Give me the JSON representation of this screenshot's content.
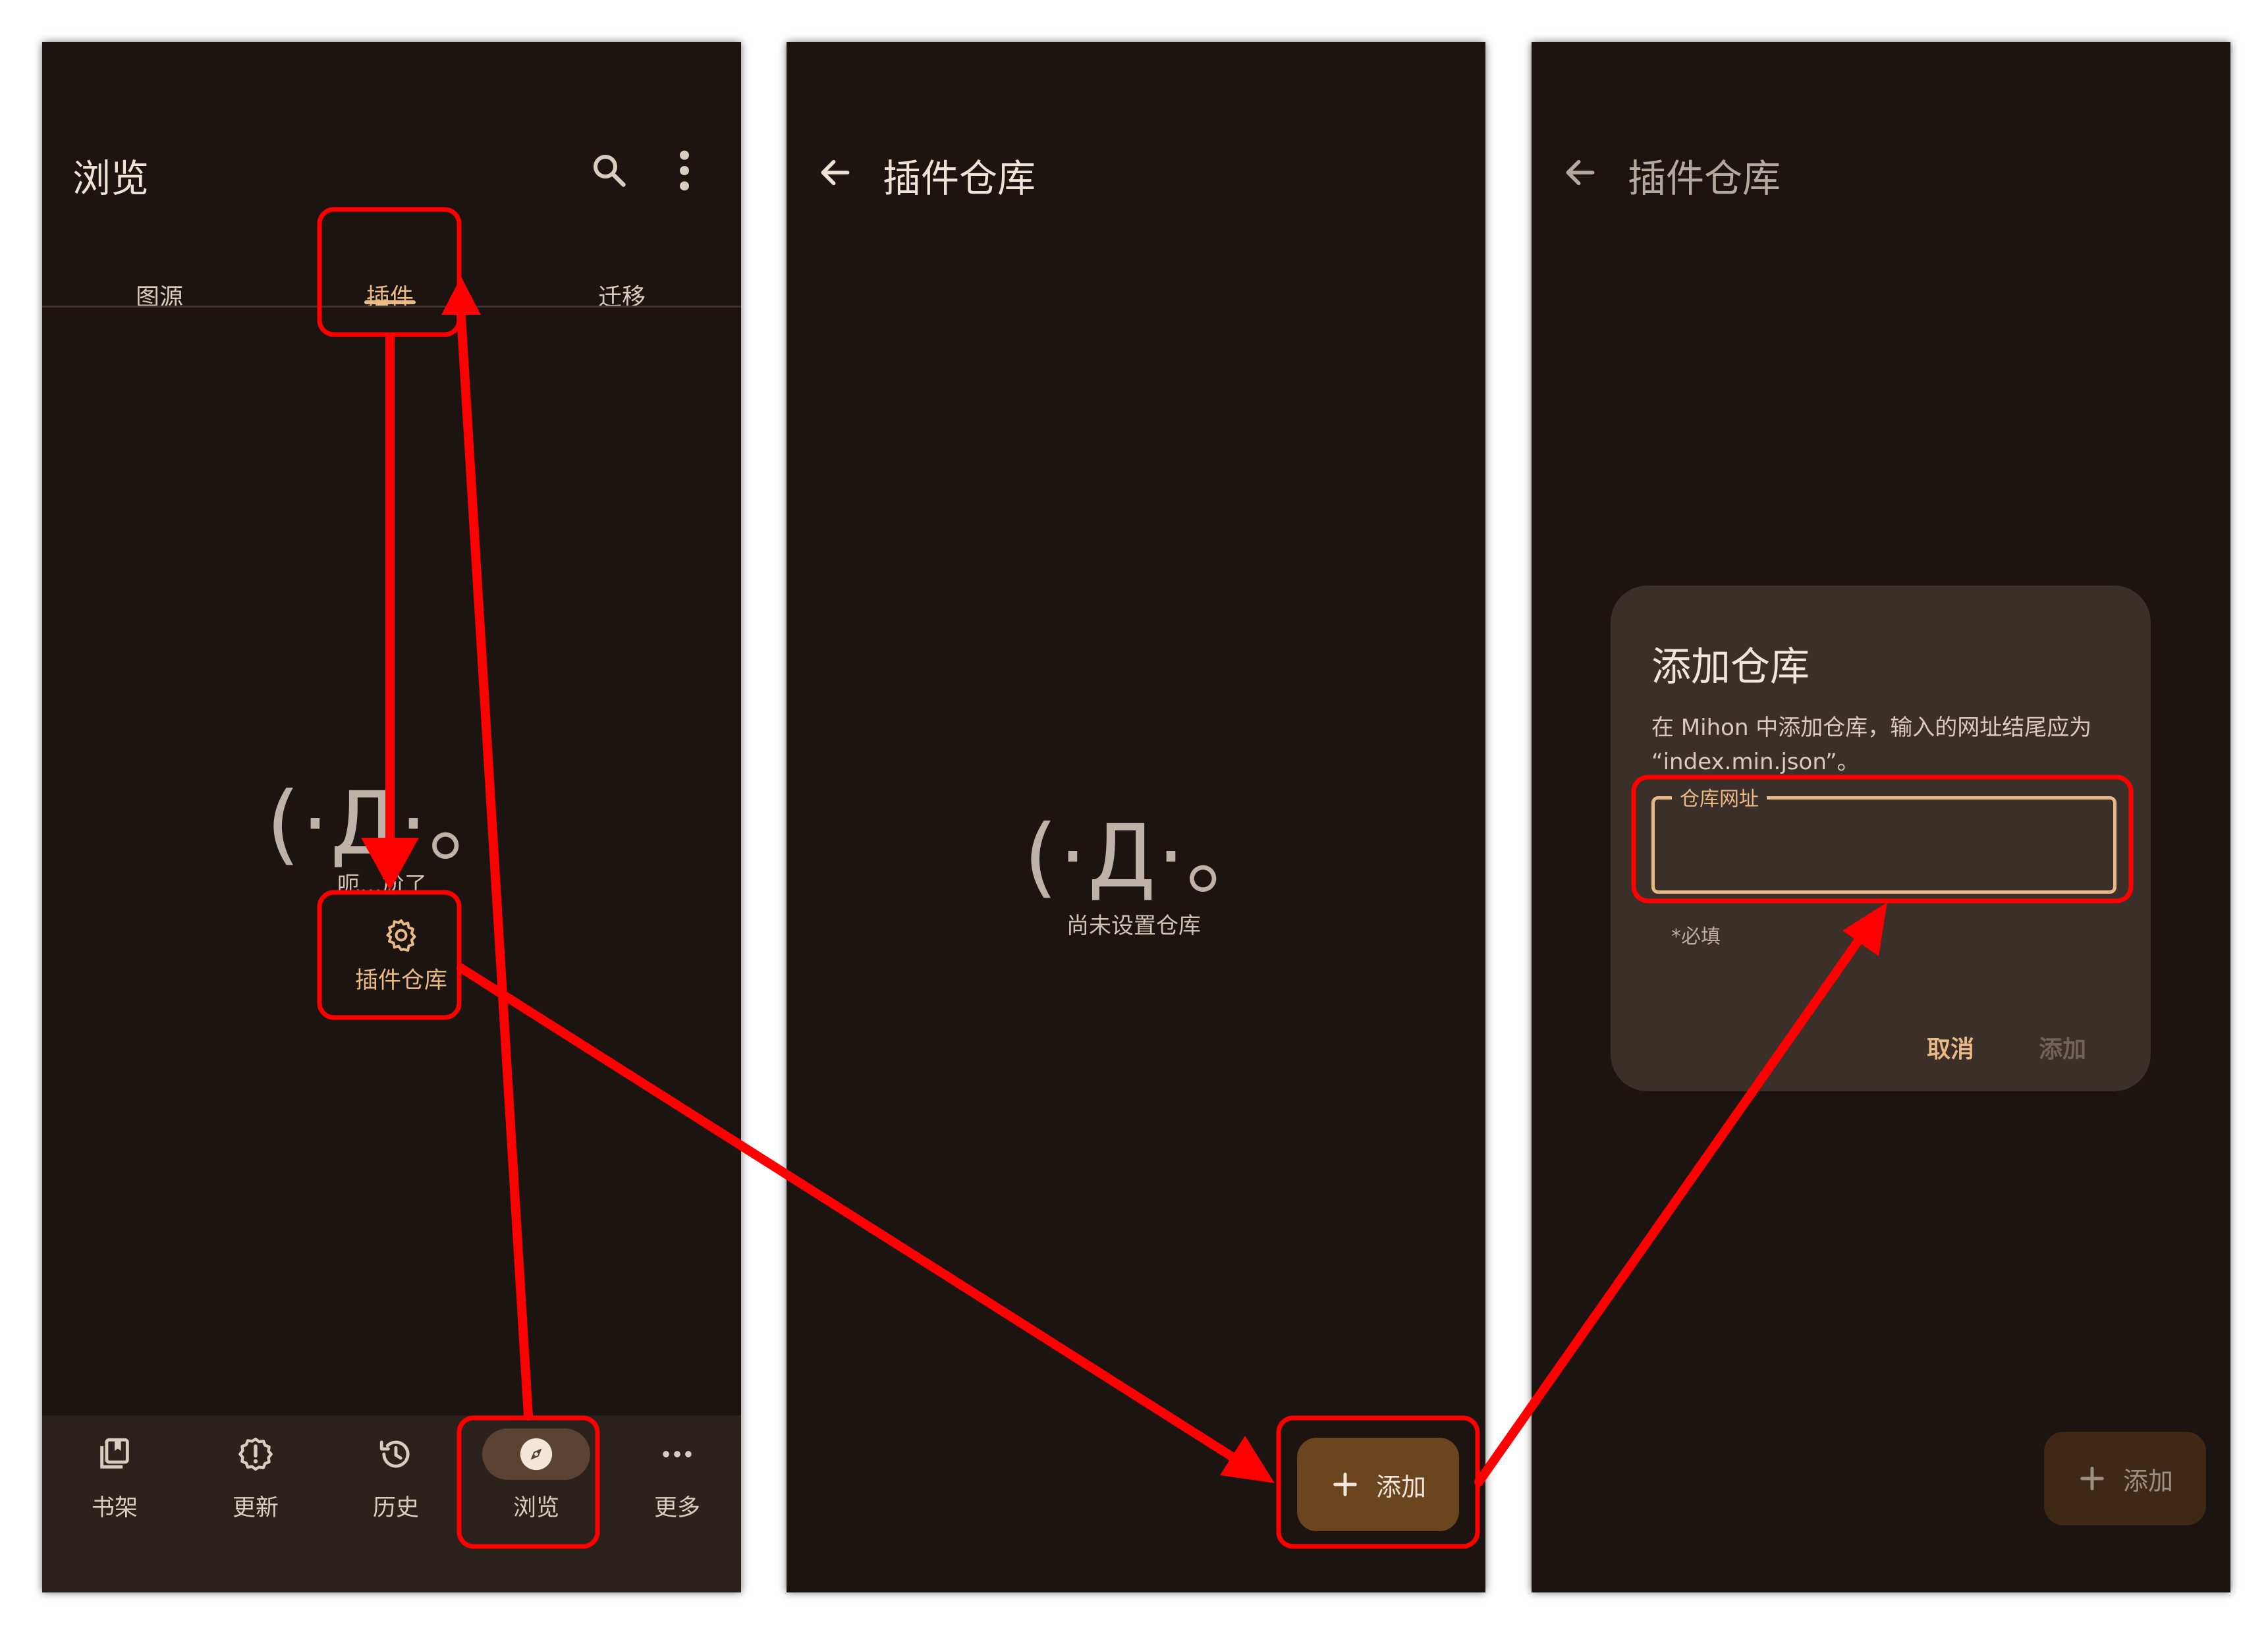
{
  "screen1": {
    "title": "浏览",
    "icons": {
      "search": "search-icon",
      "menu": "more-vert-icon"
    },
    "tabs": [
      {
        "label": "图源",
        "selected": false
      },
      {
        "label": "插件",
        "selected": true
      },
      {
        "label": "迁移",
        "selected": false
      }
    ],
    "empty_face": "(·Д·。",
    "empty_message": "呃…尬了",
    "action_label": "插件仓库",
    "nav": [
      {
        "label": "书架",
        "icon": "library-icon",
        "selected": false
      },
      {
        "label": "更新",
        "icon": "updates-icon",
        "selected": false
      },
      {
        "label": "历史",
        "icon": "history-icon",
        "selected": false
      },
      {
        "label": "浏览",
        "icon": "compass-icon",
        "selected": true
      },
      {
        "label": "更多",
        "icon": "more-horiz-icon",
        "selected": false
      }
    ]
  },
  "screen2": {
    "title": "插件仓库",
    "empty_face": "(·Д·。",
    "empty_message": "尚未设置仓库",
    "fab_label": "添加"
  },
  "screen3": {
    "title": "插件仓库",
    "dialog": {
      "title": "添加仓库",
      "description": "在 Mihon 中添加仓库，输入的网址结尾应为 “index.min.json”。",
      "field_label": "仓库网址",
      "field_value": "",
      "field_support": "*必填",
      "cancel": "取消",
      "confirm": "添加"
    },
    "fab_label": "添加"
  },
  "colors": {
    "screen_bg": "#1b1411",
    "accent": "#e9b986",
    "fab_bg": "#6b4520",
    "highlight": "#ff0000"
  }
}
